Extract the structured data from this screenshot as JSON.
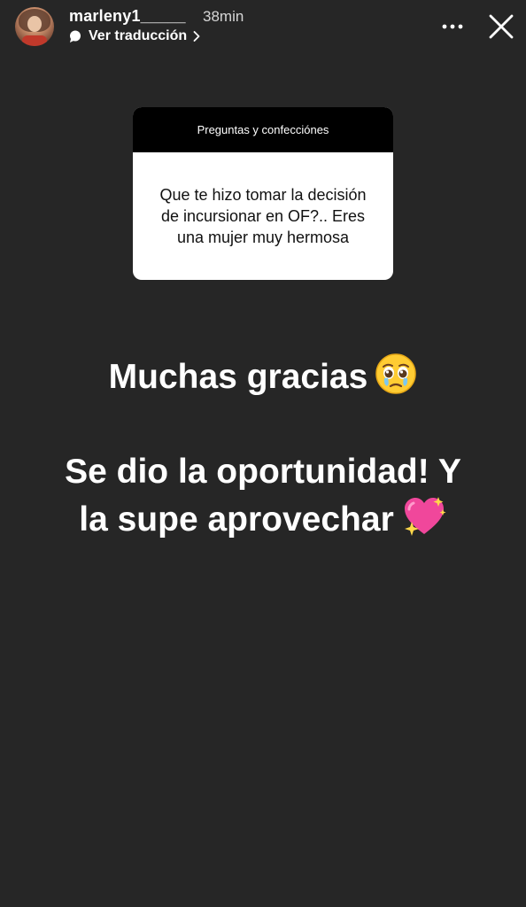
{
  "header": {
    "username": "marleny1_____",
    "time": "38min",
    "translate_label": "Ver traducción"
  },
  "icons": {
    "avatar": "profile-photo",
    "translate": "speech-bubble-icon",
    "chevron": "chevron-right-icon",
    "more": "more-dots-icon",
    "close": "close-icon",
    "reply1_emoji": "pleading-face-emoji",
    "reply2_emoji": "sparkling-heart-emoji"
  },
  "question_card": {
    "title": "Preguntas y confecciónes",
    "question": "Que te hizo tomar la decisión de incursionar en OF?.. Eres una mujer muy hermosa"
  },
  "reply": {
    "line1": "Muchas gracias",
    "line2a": "Se dio la oportunidad! Y",
    "line2b": "la supe aprovechar"
  },
  "colors": {
    "background": "#262626",
    "card_header": "#000000",
    "card_body": "#ffffff",
    "text": "#ffffff"
  }
}
